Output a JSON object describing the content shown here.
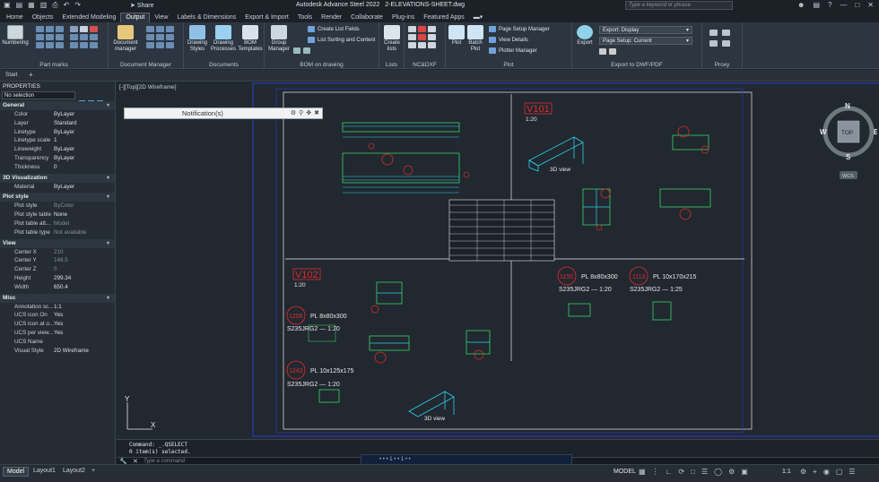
{
  "app": {
    "title": "Autodesk Advance Steel 2022",
    "file": "2-ELEVATIONS-SHEET.dwg",
    "share": "Share",
    "search_placeholder": "Type a keyword or phrase"
  },
  "tabs": [
    "Home",
    "Objects",
    "Extended Modeling",
    "Output",
    "View",
    "Labels & Dimensions",
    "Export & Import",
    "Tools",
    "Render",
    "Collaborate",
    "Plug-ins",
    "Featured Apps"
  ],
  "ribbon": {
    "numbering": "Numbering",
    "part_marks": "Part marks",
    "document_manager": "Document manager",
    "document_manager_panel": "Document Manager",
    "drawing_styles": "Drawing Styles",
    "drawing_processes": "Drawing Processes",
    "bom_templates": "BOM Templates",
    "documents": "Documents",
    "group_manager": "Group Manager",
    "create_list_fields": "Create List Fields",
    "list_sorting": "List Sorting and Content",
    "bom_on_drawing": "BOM on drawing",
    "create_lists": "Create lists",
    "lists": "Lists",
    "nc_dxf": "NC&DXF",
    "plot": "Plot",
    "batch_plot": "Batch Plot",
    "page_setup_manager": "Page Setup Manager",
    "view_details": "View Details",
    "plotter_manager": "Plotter Manager",
    "plot_panel": "Plot",
    "export": "Export",
    "export_display": "Export: Display",
    "page_setup_current": "Page Setup: Current",
    "export_dwf_pdf": "Export to DWF/PDF",
    "proxy": "Proxy"
  },
  "start_tab": "Start",
  "properties": {
    "header": "PROPERTIES",
    "selection": "No selection",
    "sections": [
      {
        "title": "General",
        "rows": [
          [
            "Color",
            "ByLayer"
          ],
          [
            "Layer",
            "Standard"
          ],
          [
            "Linetype",
            "ByLayer"
          ],
          [
            "Linetype scale",
            "1"
          ],
          [
            "Lineweight",
            "ByLayer"
          ],
          [
            "Transparency",
            "ByLayer"
          ],
          [
            "Thickness",
            "0"
          ]
        ]
      },
      {
        "title": "3D Visualization",
        "rows": [
          [
            "Material",
            "ByLayer"
          ]
        ]
      },
      {
        "title": "Plot style",
        "rows": [
          [
            "Plot style",
            "ByColor"
          ],
          [
            "Plot style table",
            "None"
          ],
          [
            "Plot table att...",
            "Model"
          ],
          [
            "Plot table type",
            "Not available"
          ]
        ]
      },
      {
        "title": "View",
        "rows": [
          [
            "Center X",
            "210"
          ],
          [
            "Center Y",
            "148.5"
          ],
          [
            "Center Z",
            "0"
          ],
          [
            "Height",
            "299.34"
          ],
          [
            "Width",
            "650.4"
          ]
        ]
      },
      {
        "title": "Misc",
        "rows": [
          [
            "Annotation sc...",
            "1:1"
          ],
          [
            "UCS icon On",
            "Yes"
          ],
          [
            "UCS icon at o...",
            "Yes"
          ],
          [
            "UCS per view...",
            "Yes"
          ],
          [
            "UCS Name",
            ""
          ],
          [
            "Visual Style",
            "2D Wireframe"
          ]
        ]
      }
    ]
  },
  "viewport_label": "[-][Top][2D Wireframe]",
  "notification": "Notification(s)",
  "viewcube": {
    "n": "N",
    "s": "S",
    "e": "E",
    "w": "W",
    "top": "TOP",
    "wcs": "WCS"
  },
  "ucs": {
    "x": "X",
    "y": "Y"
  },
  "drawing": {
    "v101": "V101",
    "v101_scale": "1:20",
    "v102": "V102",
    "v102_scale": "1:20",
    "view3d_1": "3D view",
    "view3d_2": "3D view",
    "p1155": "1155",
    "p1155_desc": "PL 8x80x300",
    "p1155_mat": "S235JRG2 — 1:20",
    "p1113": "1113",
    "p1113_desc": "PL 10x170x215",
    "p1113_mat": "S235JRG2 — 1:25",
    "p1206": "1206",
    "p1206_desc": "PL 8x80x300",
    "p1206_mat": "S235JRG2 — 1:20",
    "p1243": "1243",
    "p1243_desc": "PL 10x125x175",
    "p1243_mat": "S235JRG2 — 1:20"
  },
  "command": {
    "line1": "Command: _.QSELECT",
    "line2": "0 item(s) selected.",
    "placeholder": "Type a command"
  },
  "popup": "• • • 1 • • 1 • •",
  "status": {
    "tabs": [
      "Model",
      "Layout1",
      "Layout2"
    ],
    "model": "MODEL",
    "scale": "1:1"
  },
  "colors": {
    "accent_red": "#e02b2b",
    "cyan": "#2fd0e8",
    "green": "#3ee86a",
    "blue_frame": "#3040c8"
  }
}
